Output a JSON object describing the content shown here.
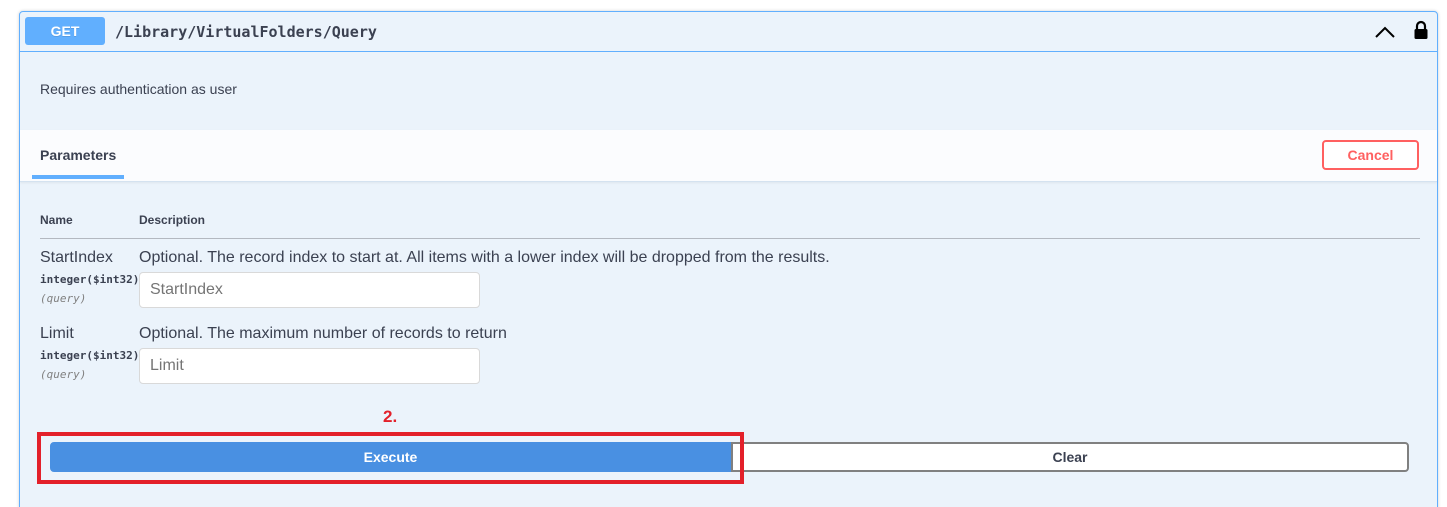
{
  "operation": {
    "method": "GET",
    "path": "/Library/VirtualFolders/Query",
    "description": "Requires authentication as user"
  },
  "parameters_section": {
    "tab_label": "Parameters",
    "cancel_label": "Cancel",
    "col_name": "Name",
    "col_description": "Description"
  },
  "params": [
    {
      "name": "StartIndex",
      "type": "integer($int32)",
      "in": "(query)",
      "description": "Optional. The record index to start at. All items with a lower index will be dropped from the results.",
      "placeholder": "StartIndex",
      "value": ""
    },
    {
      "name": "Limit",
      "type": "integer($int32)",
      "in": "(query)",
      "description": "Optional. The maximum number of records to return",
      "placeholder": "Limit",
      "value": ""
    }
  ],
  "annotation": {
    "step_label": "2."
  },
  "actions": {
    "execute_label": "Execute",
    "clear_label": "Clear"
  },
  "colors": {
    "get_accent": "#61affe",
    "execute": "#4990e2",
    "cancel": "#ff6060",
    "highlight": "#e3202a"
  },
  "icons": {
    "collapse": "chevron-up-icon",
    "auth": "lock-icon"
  }
}
